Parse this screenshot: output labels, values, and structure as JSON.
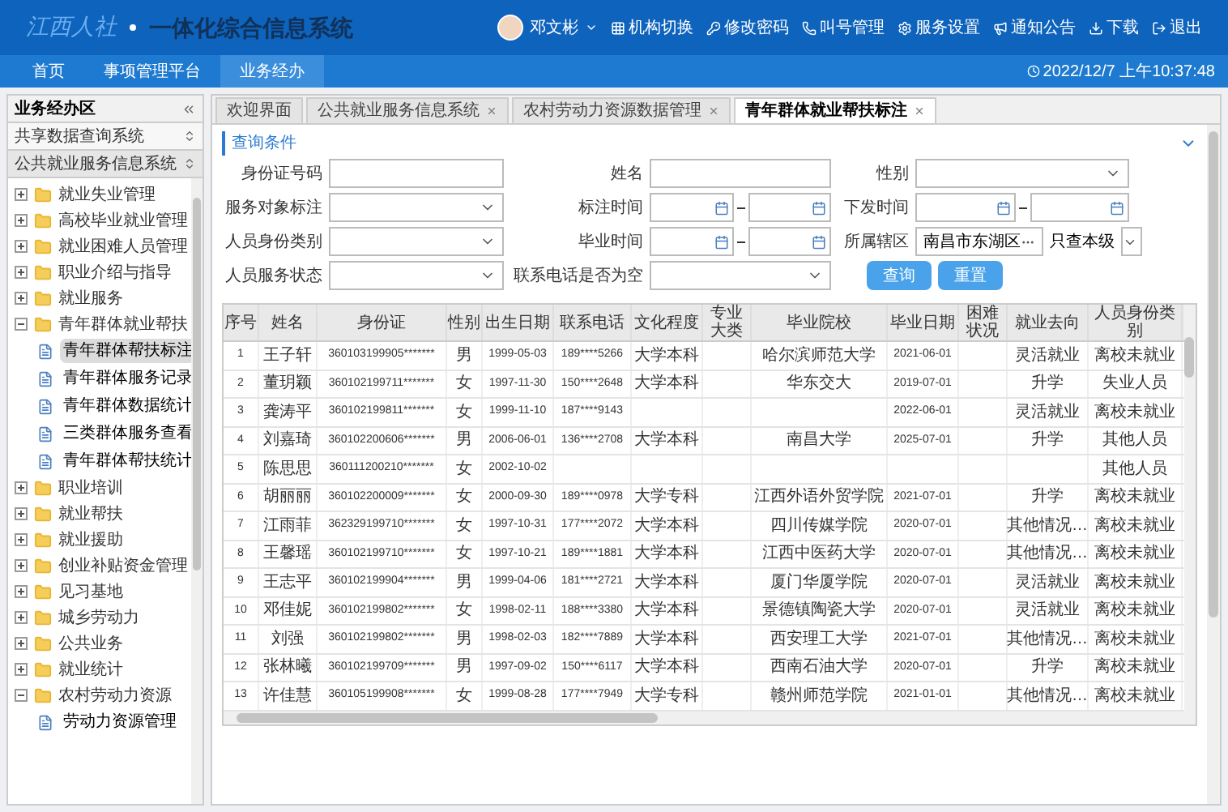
{
  "header": {
    "logo": "江西人社",
    "system_title": "一体化综合信息系统",
    "user": "邓文彬",
    "tools": [
      {
        "kind": "switch",
        "label": "机构切换"
      },
      {
        "kind": "key",
        "label": "修改密码"
      },
      {
        "kind": "call",
        "label": "叫号管理"
      },
      {
        "kind": "settings",
        "label": "服务设置"
      },
      {
        "kind": "notice",
        "label": "通知公告"
      },
      {
        "kind": "download",
        "label": "下载"
      },
      {
        "kind": "exit",
        "label": "退出"
      }
    ]
  },
  "nav": {
    "items": [
      {
        "label": "首页",
        "selected": false
      },
      {
        "label": "事项管理平台",
        "selected": false
      },
      {
        "label": "业务经办",
        "selected": true
      }
    ],
    "datetime": "2022/12/7 上午10:37:48"
  },
  "sidebar": {
    "title": "业务经办区",
    "sections": [
      {
        "label": "共享数据查询系统",
        "expanded": false
      },
      {
        "label": "公共就业服务信息系统",
        "expanded": true
      }
    ],
    "tree": [
      {
        "kind": "folder",
        "label": "就业失业管理",
        "expanded": false
      },
      {
        "kind": "folder",
        "label": "高校毕业就业管理",
        "expanded": false
      },
      {
        "kind": "folder",
        "label": "就业困难人员管理",
        "expanded": false
      },
      {
        "kind": "folder",
        "label": "职业介绍与指导",
        "expanded": false
      },
      {
        "kind": "folder",
        "label": "就业服务",
        "expanded": false
      },
      {
        "kind": "folder",
        "label": "青年群体就业帮扶",
        "expanded": true,
        "children": [
          {
            "kind": "file",
            "label": "青年群体帮扶标注",
            "selected": true
          },
          {
            "kind": "file",
            "label": "青年群体服务记录",
            "selected": false
          },
          {
            "kind": "file",
            "label": "青年群体数据统计",
            "selected": false
          },
          {
            "kind": "file",
            "label": "三类群体服务查看",
            "selected": false
          },
          {
            "kind": "file",
            "label": "青年群体帮扶统计",
            "selected": false
          }
        ]
      },
      {
        "kind": "folder",
        "label": "职业培训",
        "expanded": false
      },
      {
        "kind": "folder",
        "label": "就业帮扶",
        "expanded": false
      },
      {
        "kind": "folder",
        "label": "就业援助",
        "expanded": false
      },
      {
        "kind": "folder",
        "label": "创业补贴资金管理",
        "expanded": false
      },
      {
        "kind": "folder",
        "label": "见习基地",
        "expanded": false
      },
      {
        "kind": "folder",
        "label": "城乡劳动力",
        "expanded": false
      },
      {
        "kind": "folder",
        "label": "公共业务",
        "expanded": false
      },
      {
        "kind": "folder",
        "label": "就业统计",
        "expanded": false
      },
      {
        "kind": "folder",
        "label": "农村劳动力资源",
        "expanded": true,
        "children": [
          {
            "kind": "file",
            "label": "劳动力资源管理",
            "selected": false
          }
        ]
      }
    ]
  },
  "tabs": [
    {
      "label": "欢迎界面",
      "selected": false,
      "closable": false
    },
    {
      "label": "公共就业服务信息系统",
      "selected": false,
      "closable": true
    },
    {
      "label": "农村劳动力资源数据管理",
      "selected": false,
      "closable": true
    },
    {
      "label": "青年群体就业帮扶标注",
      "selected": true,
      "closable": true
    }
  ],
  "query": {
    "title": "查询条件",
    "fields": [
      {
        "kind": "text",
        "label": "身份证号码"
      },
      {
        "kind": "text",
        "label": "姓名"
      },
      {
        "kind": "select",
        "label": "性别"
      },
      {
        "kind": "select",
        "label": "服务对象标注"
      },
      {
        "kind": "date_range",
        "label": "标注时间"
      },
      {
        "kind": "date_range",
        "label": "下发时间"
      },
      {
        "kind": "select",
        "label": "人员身份类别"
      },
      {
        "kind": "date_range",
        "label": "毕业时间"
      },
      {
        "kind": "region",
        "label": "所属辖区",
        "value": "南昌市东湖区",
        "extra_label": "只查本级"
      },
      {
        "kind": "select",
        "label": "人员服务状态"
      },
      {
        "kind": "select",
        "label": "联系电话是否为空"
      }
    ],
    "buttons": [
      "查询",
      "重置"
    ]
  },
  "table": {
    "columns": [
      "序号",
      "姓名",
      "身份证",
      "性别",
      "出生日期",
      "联系电话",
      "文化程度",
      "专业大类",
      "毕业院校",
      "毕业日期",
      "困难状况",
      "就业去向",
      "人员身份类别"
    ],
    "rows": [
      [
        "1",
        "王子轩",
        "360103199905*******",
        "男",
        "1999-05-03",
        "189****5266",
        "大学本科",
        "",
        "哈尔滨师范大学",
        "2021-06-01",
        "",
        "灵活就业",
        "离校未就业"
      ],
      [
        "2",
        "董玥颖",
        "360102199711*******",
        "女",
        "1997-11-30",
        "150****2648",
        "大学本科",
        "",
        "华东交大",
        "2019-07-01",
        "",
        "升学",
        "失业人员"
      ],
      [
        "3",
        "龚涛平",
        "360102199811*******",
        "女",
        "1999-11-10",
        "187****9143",
        "",
        "",
        "",
        "2022-06-01",
        "",
        "灵活就业",
        "离校未就业"
      ],
      [
        "4",
        "刘嘉琦",
        "360102200606*******",
        "男",
        "2006-06-01",
        "136****2708",
        "大学本科",
        "",
        "南昌大学",
        "2025-07-01",
        "",
        "升学",
        "其他人员"
      ],
      [
        "5",
        "陈思思",
        "360111200210*******",
        "女",
        "2002-10-02",
        "",
        "",
        "",
        "",
        "",
        "",
        "",
        "其他人员"
      ],
      [
        "6",
        "胡丽丽",
        "360102200009*******",
        "女",
        "2000-09-30",
        "189****0978",
        "大学专科",
        "",
        "江西外语外贸学院",
        "2021-07-01",
        "",
        "升学",
        "离校未就业"
      ],
      [
        "7",
        "江雨菲",
        "362329199710*******",
        "女",
        "1997-10-31",
        "177****2072",
        "大学本科",
        "",
        "四川传媒学院",
        "2020-07-01",
        "",
        "其他情况…",
        "离校未就业"
      ],
      [
        "8",
        "王馨瑶",
        "360102199710*******",
        "女",
        "1997-10-21",
        "189****1881",
        "大学本科",
        "",
        "江西中医药大学",
        "2020-07-01",
        "",
        "其他情况…",
        "离校未就业"
      ],
      [
        "9",
        "王志平",
        "360102199904*******",
        "男",
        "1999-04-06",
        "181****2721",
        "大学本科",
        "",
        "厦门华厦学院",
        "2020-07-01",
        "",
        "灵活就业",
        "离校未就业"
      ],
      [
        "10",
        "邓佳妮",
        "360102199802*******",
        "女",
        "1998-02-11",
        "188****3380",
        "大学本科",
        "",
        "景德镇陶瓷大学",
        "2020-07-01",
        "",
        "灵活就业",
        "离校未就业"
      ],
      [
        "11",
        "刘强",
        "360102199802*******",
        "男",
        "1998-02-03",
        "182****7889",
        "大学本科",
        "",
        "西安理工大学",
        "2021-07-01",
        "",
        "其他情况…",
        "离校未就业"
      ],
      [
        "12",
        "张林曦",
        "360102199709*******",
        "男",
        "1997-09-02",
        "150****6117",
        "大学本科",
        "",
        "西南石油大学",
        "2020-07-01",
        "",
        "升学",
        "离校未就业"
      ],
      [
        "13",
        "许佳慧",
        "360105199908*******",
        "女",
        "1999-08-28",
        "177****7949",
        "大学专科",
        "",
        "赣州师范学院",
        "2021-01-01",
        "",
        "其他情况…",
        "离校未就业"
      ]
    ]
  }
}
